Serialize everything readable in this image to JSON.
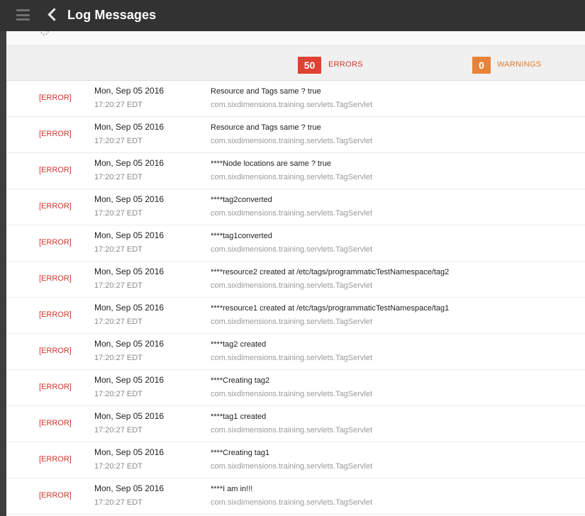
{
  "header": {
    "title": "Log Messages"
  },
  "summary": {
    "errors_count": "50",
    "errors_label": "ERRORS",
    "warnings_count": "0",
    "warnings_label": "WARNINGS"
  },
  "colors": {
    "error_badge": "#e14132",
    "warning_badge": "#e8823a",
    "titlebar": "#323232"
  },
  "rows": [
    {
      "level": "[ERROR]",
      "date": "Mon, Sep 05 2016",
      "time": "17:20:27 EDT",
      "message": "Resource and Tags same ? true",
      "source": "com.sixdimensions.training.servlets.TagServlet"
    },
    {
      "level": "[ERROR]",
      "date": "Mon, Sep 05 2016",
      "time": "17:20:27 EDT",
      "message": "Resource and Tags same ? true",
      "source": "com.sixdimensions.training.servlets.TagServlet"
    },
    {
      "level": "[ERROR]",
      "date": "Mon, Sep 05 2016",
      "time": "17:20:27 EDT",
      "message": "****Node locations are same ? true",
      "source": "com.sixdimensions.training.servlets.TagServlet"
    },
    {
      "level": "[ERROR]",
      "date": "Mon, Sep 05 2016",
      "time": "17:20:27 EDT",
      "message": "****tag2converted",
      "source": "com.sixdimensions.training.servlets.TagServlet"
    },
    {
      "level": "[ERROR]",
      "date": "Mon, Sep 05 2016",
      "time": "17:20:27 EDT",
      "message": "****tag1converted",
      "source": "com.sixdimensions.training.servlets.TagServlet"
    },
    {
      "level": "[ERROR]",
      "date": "Mon, Sep 05 2016",
      "time": "17:20:27 EDT",
      "message": "****resource2 created at /etc/tags/programmaticTestNamespace/tag2",
      "source": "com.sixdimensions.training.servlets.TagServlet"
    },
    {
      "level": "[ERROR]",
      "date": "Mon, Sep 05 2016",
      "time": "17:20:27 EDT",
      "message": "****resource1 created at /etc/tags/programmaticTestNamespace/tag1",
      "source": "com.sixdimensions.training.servlets.TagServlet"
    },
    {
      "level": "[ERROR]",
      "date": "Mon, Sep 05 2016",
      "time": "17:20:27 EDT",
      "message": "****tag2 created",
      "source": "com.sixdimensions.training.servlets.TagServlet"
    },
    {
      "level": "[ERROR]",
      "date": "Mon, Sep 05 2016",
      "time": "17:20:27 EDT",
      "message": "****Creating tag2",
      "source": "com.sixdimensions.training.servlets.TagServlet"
    },
    {
      "level": "[ERROR]",
      "date": "Mon, Sep 05 2016",
      "time": "17:20:27 EDT",
      "message": "****tag1 created",
      "source": "com.sixdimensions.training.servlets.TagServlet"
    },
    {
      "level": "[ERROR]",
      "date": "Mon, Sep 05 2016",
      "time": "17:20:27 EDT",
      "message": "****Creating tag1",
      "source": "com.sixdimensions.training.servlets.TagServlet"
    },
    {
      "level": "[ERROR]",
      "date": "Mon, Sep 05 2016",
      "time": "17:20:27 EDT",
      "message": "****I am in!!!",
      "source": "com.sixdimensions.training.servlets.TagServlet"
    }
  ]
}
